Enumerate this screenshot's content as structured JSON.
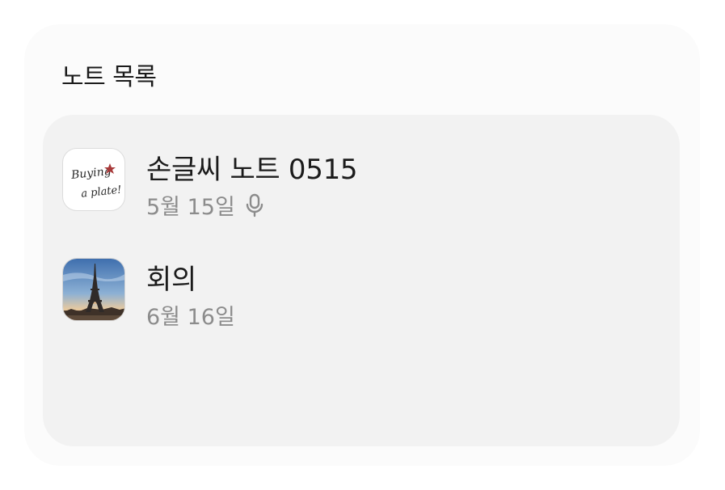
{
  "widget": {
    "title": "노트 목록"
  },
  "notes": [
    {
      "title": "손글씨 노트 0515",
      "date": "5월 15일",
      "thumbnail_text": "Buying a plate!",
      "thumbnail_icon": "handwriting-thumbnail",
      "has_audio": true,
      "audio_icon": "microphone-icon"
    },
    {
      "title": "회의",
      "date": "6월 16일",
      "thumbnail_icon": "eiffel-tower-photo-thumbnail",
      "has_audio": false
    }
  ],
  "colors": {
    "widget_bg": "#fbfbfb",
    "card_bg": "#f2f2f2",
    "title_text": "#1b1b1b",
    "meta_text": "#8c8c8c"
  }
}
